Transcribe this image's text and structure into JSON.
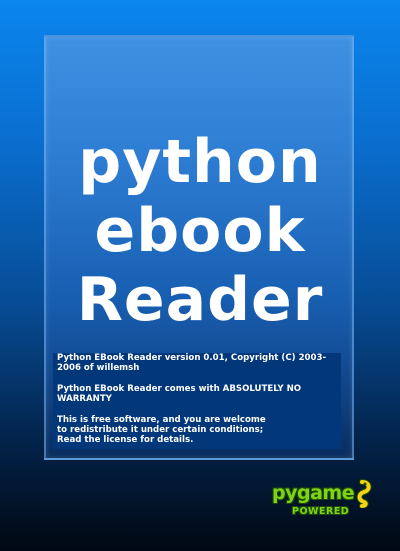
{
  "splash": {
    "title_lines": [
      "python",
      "ebook",
      "Reader"
    ],
    "info": {
      "line1": "Python EBook Reader version 0.01, Copyright (C) 2003-2006 of willemsh",
      "line2": "Python EBook Reader comes with ABSOLUTELY NO WARRANTY",
      "line3a": "This is free software, and you are welcome",
      "line3b": "to redistribute it under certain conditions;",
      "line3c": "Read the license for details."
    },
    "logo": {
      "word": "pygame",
      "sub": "POWERED",
      "icon": "snake-icon"
    }
  },
  "colors": {
    "text": "#ffffff",
    "info_background": "#02377a",
    "logo_green": "#7fd317",
    "logo_yellow": "#f5d312"
  }
}
